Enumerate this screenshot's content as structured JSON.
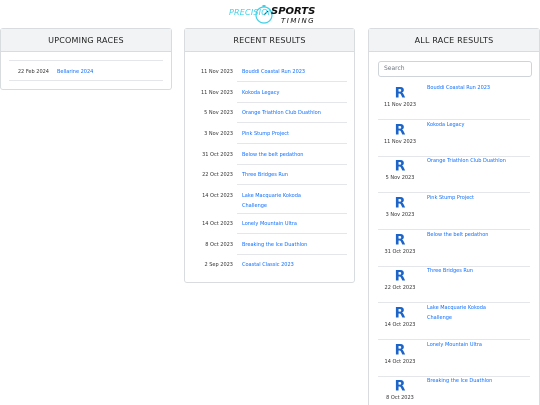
{
  "brand": {
    "logo_line1": "PRECISION",
    "logo_line2": "SPORTS",
    "logo_line3": "TIMING",
    "accent_color": "#3fd0e6"
  },
  "upcoming": {
    "title": "UPCOMING RACES",
    "items": [
      {
        "date": "22 Feb 2024",
        "name": "Bellarine 2024"
      }
    ]
  },
  "recent": {
    "title": "RECENT RESULTS",
    "items": [
      {
        "date": "11 Nov 2023",
        "name": "Bouddi Coastal Run 2023"
      },
      {
        "date": "11 Nov 2023",
        "name": "Kokoda Legacy"
      },
      {
        "date": "5 Nov 2023",
        "name": "Orange Triathlon Club Duathlon"
      },
      {
        "date": "3 Nov 2023",
        "name": "Pink Stump Project"
      },
      {
        "date": "31 Oct 2023",
        "name": "Below the belt pedathon"
      },
      {
        "date": "22 Oct 2023",
        "name": "Three Bridges Run"
      },
      {
        "date": "14 Oct 2023",
        "name_line1": "Lake Macquarie Kokoda",
        "name_line2": "Challenge"
      },
      {
        "date": "14 Oct 2023",
        "name": "Lonely Mountain Ultra"
      },
      {
        "date": "8 Oct 2023",
        "name": "Breaking the Ice Duathlon"
      },
      {
        "date": "2 Sep 2023",
        "name": "Coastal Classic 2023"
      }
    ]
  },
  "all_results": {
    "title": "ALL RACE RESULTS",
    "search_placeholder": "Search",
    "icon_letter": "R",
    "icon_color": "#1c64c8",
    "items": [
      {
        "date": "11 Nov 2023",
        "name": "Bouddi Coastal Run 2023"
      },
      {
        "date": "11 Nov 2023",
        "name": "Kokoda Legacy"
      },
      {
        "date": "5 Nov 2023",
        "name": "Orange Triathlon Club Duathlon"
      },
      {
        "date": "3 Nov 2023",
        "name": "Pink Stump Project"
      },
      {
        "date": "31 Oct 2023",
        "name": "Below the belt pedathon"
      },
      {
        "date": "22 Oct 2023",
        "name": "Three Bridges Run"
      },
      {
        "date": "14 Oct 2023",
        "name_line1": "Lake Macquarie Kokoda",
        "name_line2": "Challenge"
      },
      {
        "date": "14 Oct 2023",
        "name": "Lonely Mountain Ultra"
      },
      {
        "date": "8 Oct 2023",
        "name": "Breaking the Ice Duathlon"
      }
    ]
  }
}
